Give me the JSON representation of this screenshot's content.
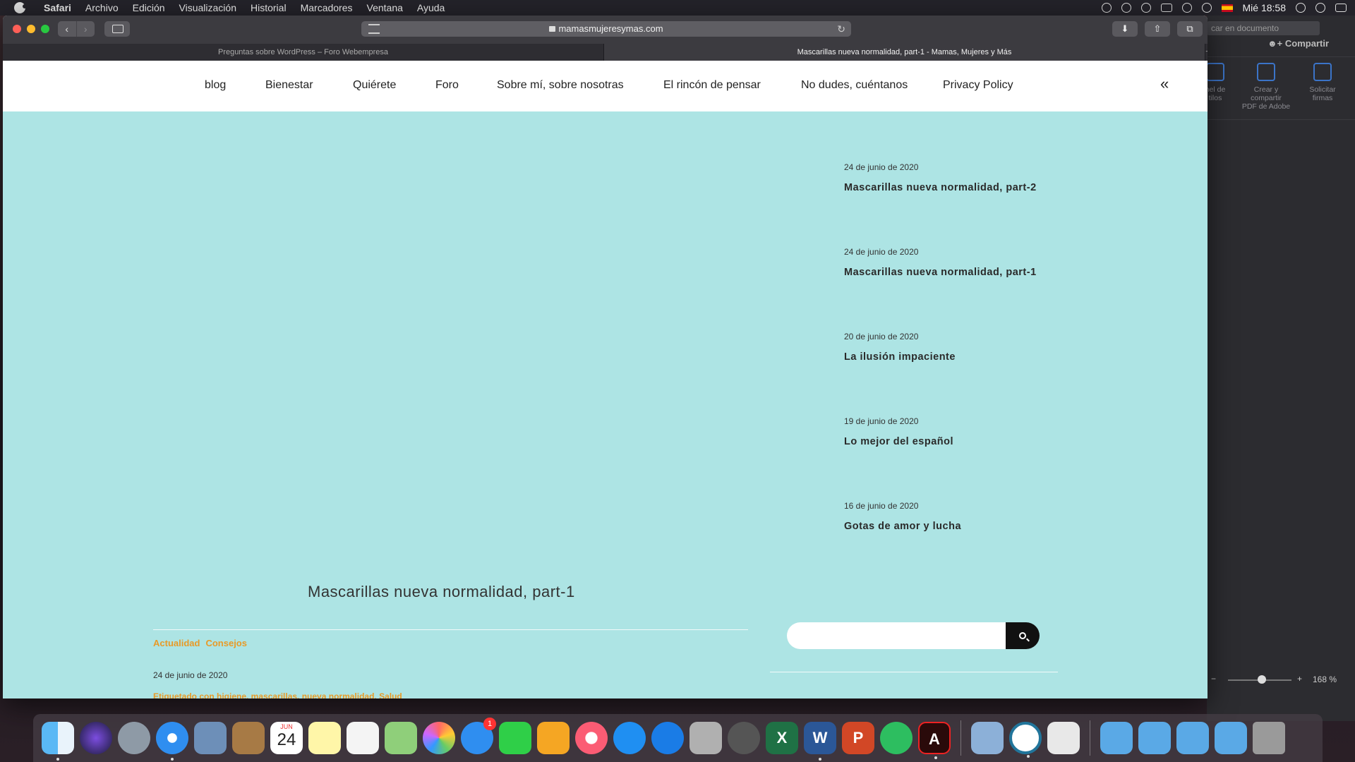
{
  "menubar": {
    "app": "Safari",
    "menus": [
      "Archivo",
      "Edición",
      "Visualización",
      "Historial",
      "Marcadores",
      "Ventana",
      "Ayuda"
    ],
    "clock": "Mié 18:58"
  },
  "acrobat": {
    "search_placeholder": "car en documento",
    "share": "Compartir",
    "tools": [
      {
        "label": "nel de\ntilos"
      },
      {
        "label": "Crear y compartir\nPDF de Adobe"
      },
      {
        "label": "Solicitar\nfirmas"
      }
    ],
    "zoom_level": "168 %"
  },
  "browser": {
    "url": "mamasmujeresymas.com",
    "tabs": [
      {
        "label": "Preguntas sobre WordPress – Foro Webempresa",
        "active": false
      },
      {
        "label": "Mascarillas nueva normalidad, part-1 - Mamas, Mujeres y Más",
        "active": true
      }
    ]
  },
  "site": {
    "nav": [
      "blog",
      "Bienestar",
      "Quiérete",
      "Foro",
      "Sobre mí, sobre nosotras",
      "El rincón de pensar",
      "No dudes, cuéntanos",
      "Privacy Policy"
    ],
    "recent_posts": [
      {
        "date": "24 de junio de 2020",
        "title": "Mascarillas nueva normalidad, part-2"
      },
      {
        "date": "24 de junio de 2020",
        "title": "Mascarillas nueva normalidad, part-1"
      },
      {
        "date": "20 de junio de 2020",
        "title": "La ilusión impaciente"
      },
      {
        "date": "19 de junio de 2020",
        "title": "Lo mejor del español"
      },
      {
        "date": "16 de junio de 2020",
        "title": "Gotas de amor y lucha"
      }
    ],
    "post": {
      "title": "Mascarillas nueva normalidad, part-1",
      "categories": [
        "Actualidad",
        "Consejos"
      ],
      "date": "24 de junio de 2020",
      "tags_line": "Etiquetado con higiene, mascarillas, nueva normalidad, Salud"
    }
  },
  "dock": {
    "calendar_day": "24",
    "messages_badge": "1"
  }
}
